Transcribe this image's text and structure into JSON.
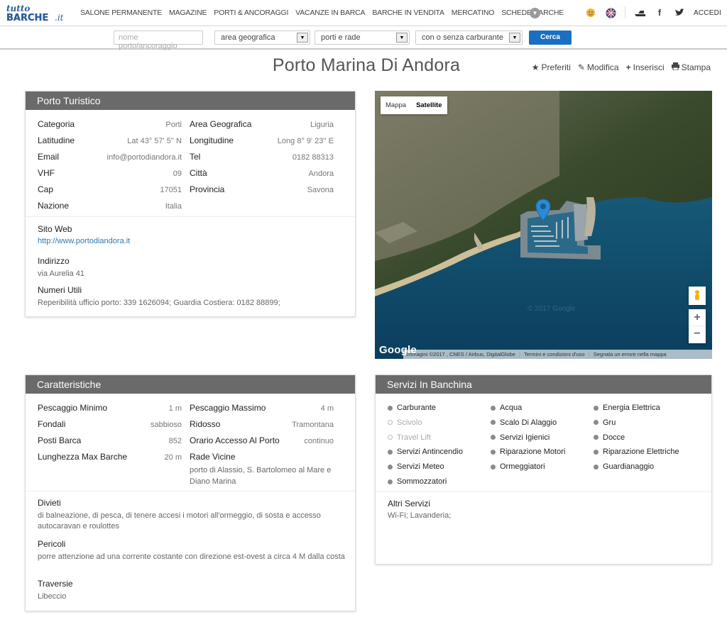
{
  "nav": {
    "logo_text": "tuttoBARCHE.it",
    "items": [
      "SALONE PERMANENTE",
      "MAGAZINE",
      "PORTI & ANCORAGGI",
      "VACANZE IN BARCA",
      "BARCHE IN VENDITA",
      "MERCATINO",
      "SCHEDE BARCHE"
    ],
    "login": "ACCEDI"
  },
  "search": {
    "name_placeholder": "nome porto/ancoraggio",
    "area": "area geografica",
    "type": "porti e rade",
    "fuel": "con o senza carburante",
    "button": "Cerca"
  },
  "page": {
    "title": "Porto Marina Di Andora",
    "actions": {
      "favorites": "Preferiti",
      "edit": "Modifica",
      "insert": "Inserisci",
      "print": "Stampa"
    }
  },
  "porto": {
    "heading": "Porto Turistico",
    "left": [
      {
        "label": "Categoria",
        "value": "Porti"
      },
      {
        "label": "Latitudine",
        "value": "Lat 43° 57' 5'' N"
      },
      {
        "label": "Email",
        "value": "info@portodiandora.it"
      },
      {
        "label": "VHF",
        "value": "09"
      },
      {
        "label": "Cap",
        "value": "17051"
      },
      {
        "label": "Nazione",
        "value": "Italia"
      }
    ],
    "right": [
      {
        "label": "Area Geografica",
        "value": "Liguria"
      },
      {
        "label": "Longitudine",
        "value": "Long 8° 9' 23'' E"
      },
      {
        "label": "Tel",
        "value": "0182 88313"
      },
      {
        "label": "Città",
        "value": "Andora"
      },
      {
        "label": "Provincia",
        "value": "Savona"
      }
    ],
    "website_label": "Sito Web",
    "website": "http://www.portodiandora.it",
    "address_label": "Indirizzo",
    "address": "via Aurelia 41",
    "numbers_label": "Numeri Utili",
    "numbers": "Reperibilità ufficio porto: 339 1626094; Guardia Costiera: 0182 88899;"
  },
  "map": {
    "tab_map": "Mappa",
    "tab_satellite": "Satellite",
    "brand": "Google",
    "attribution": "Immagini ©2017 , CNES / Airbus, DigitalGlobe",
    "terms": "Termini e condizioni d'uso",
    "report": "Segnala un errore nella mappa",
    "watermark": "© 2017 Google",
    "zoom_in": "+",
    "zoom_out": "−"
  },
  "caratteristiche": {
    "heading": "Caratteristiche",
    "left": [
      {
        "label": "Pescaggio Minimo",
        "value": "1 m"
      },
      {
        "label": "Fondali",
        "value": "sabbioso"
      },
      {
        "label": "Posti Barca",
        "value": "852"
      },
      {
        "label": "Lunghezza Max Barche",
        "value": "20 m"
      }
    ],
    "right": [
      {
        "label": "Pescaggio Massimo",
        "value": "4 m"
      },
      {
        "label": "Ridosso",
        "value": "Tramontana"
      },
      {
        "label": "Orario Accesso Al Porto",
        "value": "continuo"
      },
      {
        "label": "Rade Vicine",
        "value": "porto di Alassio, S. Bartolomeo al Mare e Diano Marina"
      }
    ],
    "divieti_label": "Divieti",
    "divieti": "di balneazione, di pesca, di tenere accesi i motori all'ormeggio, di sosta e accesso autocaravan e roulottes",
    "pericoli_label": "Pericoli",
    "pericoli": "porre attenzione ad una corrente costante con direzione est-ovest a circa 4 M dalla costa",
    "traversie_label": "Traversie",
    "traversie": "Libeccio"
  },
  "servizi": {
    "heading": "Servizi In Banchina",
    "items": [
      {
        "label": "Carburante",
        "available": true
      },
      {
        "label": "Acqua",
        "available": true
      },
      {
        "label": "Energia Elettrica",
        "available": true
      },
      {
        "label": "Scivolo",
        "available": false
      },
      {
        "label": "Scalo Di Alaggio",
        "available": true
      },
      {
        "label": "Gru",
        "available": true
      },
      {
        "label": "Travel Lift",
        "available": false
      },
      {
        "label": "Servizi Igienici",
        "available": true
      },
      {
        "label": "Docce",
        "available": true
      },
      {
        "label": "Servizi Antincendio",
        "available": true
      },
      {
        "label": "Riparazione Motori",
        "available": true
      },
      {
        "label": " Riparazione Elettriche",
        "available": true
      },
      {
        "label": "Servizi Meteo",
        "available": true
      },
      {
        "label": "Ormeggiatori",
        "available": true
      },
      {
        "label": "Guardianaggio",
        "available": true
      },
      {
        "label": "Sommozzatori",
        "available": true
      }
    ],
    "altri_label": "Altri Servizi",
    "altri": "Wi-Fi; Lavanderia;"
  }
}
